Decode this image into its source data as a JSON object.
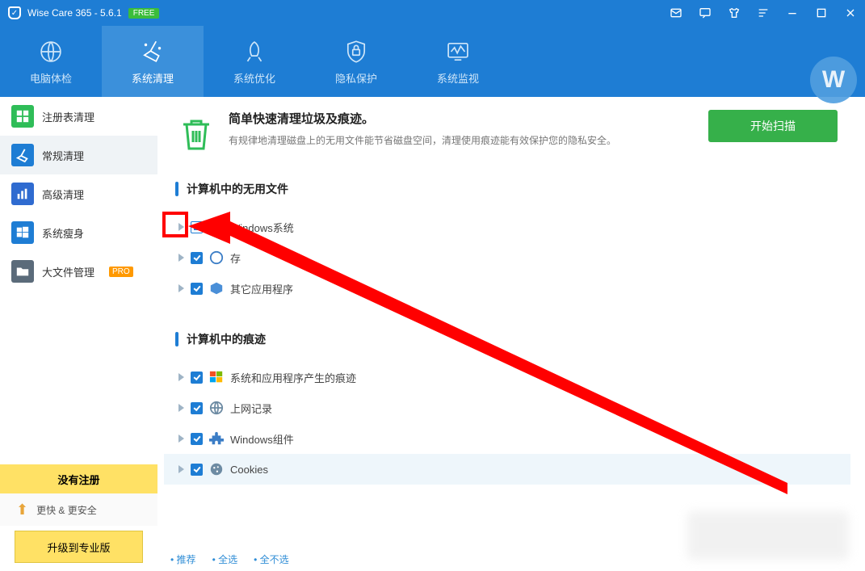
{
  "title": {
    "text": "Wise Care 365 - 5.6.1",
    "badge": "FREE"
  },
  "nav": [
    {
      "label": "电脑体检"
    },
    {
      "label": "系统清理"
    },
    {
      "label": "系统优化"
    },
    {
      "label": "隐私保护"
    },
    {
      "label": "系统监视"
    }
  ],
  "sidebar": {
    "items": [
      {
        "label": "注册表清理"
      },
      {
        "label": "常规清理"
      },
      {
        "label": "高级清理"
      },
      {
        "label": "系统瘦身"
      },
      {
        "label": "大文件管理",
        "pro": "PRO"
      }
    ],
    "noreg": "没有注册",
    "upg1": "更快 & 更安全",
    "upg2": "升级到专业版"
  },
  "header": {
    "title": "简单快速清理垃圾及痕迹。",
    "subtitle": "有规律地清理磁盘上的无用文件能节省磁盘空间，清理使用痕迹能有效保护您的隐私安全。",
    "start": "开始扫描"
  },
  "section1": {
    "title": "计算机中的无用文件",
    "rows": [
      {
        "label": "Windows系统",
        "state": "partial"
      },
      {
        "label": "存",
        "state": "checked"
      },
      {
        "label": "其它应用程序",
        "state": "checked"
      }
    ]
  },
  "section2": {
    "title": "计算机中的痕迹",
    "rows": [
      {
        "label": "系统和应用程序产生的痕迹",
        "state": "checked"
      },
      {
        "label": "上网记录",
        "state": "checked"
      },
      {
        "label": "Windows组件",
        "state": "checked"
      },
      {
        "label": "Cookies",
        "state": "checked"
      }
    ]
  },
  "footer": {
    "a": "推荐",
    "b": "全选",
    "c": "全不选"
  }
}
